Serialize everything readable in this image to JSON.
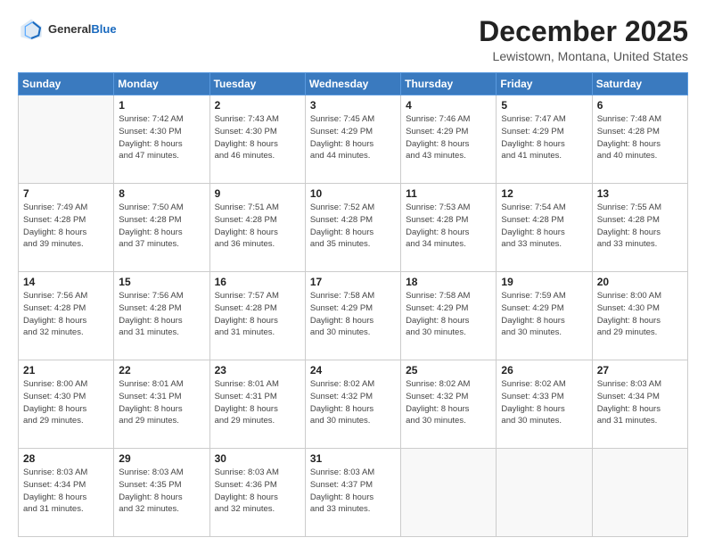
{
  "logo": {
    "general": "General",
    "blue": "Blue"
  },
  "header": {
    "month": "December 2025",
    "location": "Lewistown, Montana, United States"
  },
  "days_of_week": [
    "Sunday",
    "Monday",
    "Tuesday",
    "Wednesday",
    "Thursday",
    "Friday",
    "Saturday"
  ],
  "weeks": [
    [
      {
        "day": "",
        "info": ""
      },
      {
        "day": "1",
        "info": "Sunrise: 7:42 AM\nSunset: 4:30 PM\nDaylight: 8 hours\nand 47 minutes."
      },
      {
        "day": "2",
        "info": "Sunrise: 7:43 AM\nSunset: 4:30 PM\nDaylight: 8 hours\nand 46 minutes."
      },
      {
        "day": "3",
        "info": "Sunrise: 7:45 AM\nSunset: 4:29 PM\nDaylight: 8 hours\nand 44 minutes."
      },
      {
        "day": "4",
        "info": "Sunrise: 7:46 AM\nSunset: 4:29 PM\nDaylight: 8 hours\nand 43 minutes."
      },
      {
        "day": "5",
        "info": "Sunrise: 7:47 AM\nSunset: 4:29 PM\nDaylight: 8 hours\nand 41 minutes."
      },
      {
        "day": "6",
        "info": "Sunrise: 7:48 AM\nSunset: 4:28 PM\nDaylight: 8 hours\nand 40 minutes."
      }
    ],
    [
      {
        "day": "7",
        "info": "Sunrise: 7:49 AM\nSunset: 4:28 PM\nDaylight: 8 hours\nand 39 minutes."
      },
      {
        "day": "8",
        "info": "Sunrise: 7:50 AM\nSunset: 4:28 PM\nDaylight: 8 hours\nand 37 minutes."
      },
      {
        "day": "9",
        "info": "Sunrise: 7:51 AM\nSunset: 4:28 PM\nDaylight: 8 hours\nand 36 minutes."
      },
      {
        "day": "10",
        "info": "Sunrise: 7:52 AM\nSunset: 4:28 PM\nDaylight: 8 hours\nand 35 minutes."
      },
      {
        "day": "11",
        "info": "Sunrise: 7:53 AM\nSunset: 4:28 PM\nDaylight: 8 hours\nand 34 minutes."
      },
      {
        "day": "12",
        "info": "Sunrise: 7:54 AM\nSunset: 4:28 PM\nDaylight: 8 hours\nand 33 minutes."
      },
      {
        "day": "13",
        "info": "Sunrise: 7:55 AM\nSunset: 4:28 PM\nDaylight: 8 hours\nand 33 minutes."
      }
    ],
    [
      {
        "day": "14",
        "info": "Sunrise: 7:56 AM\nSunset: 4:28 PM\nDaylight: 8 hours\nand 32 minutes."
      },
      {
        "day": "15",
        "info": "Sunrise: 7:56 AM\nSunset: 4:28 PM\nDaylight: 8 hours\nand 31 minutes."
      },
      {
        "day": "16",
        "info": "Sunrise: 7:57 AM\nSunset: 4:28 PM\nDaylight: 8 hours\nand 31 minutes."
      },
      {
        "day": "17",
        "info": "Sunrise: 7:58 AM\nSunset: 4:29 PM\nDaylight: 8 hours\nand 30 minutes."
      },
      {
        "day": "18",
        "info": "Sunrise: 7:58 AM\nSunset: 4:29 PM\nDaylight: 8 hours\nand 30 minutes."
      },
      {
        "day": "19",
        "info": "Sunrise: 7:59 AM\nSunset: 4:29 PM\nDaylight: 8 hours\nand 30 minutes."
      },
      {
        "day": "20",
        "info": "Sunrise: 8:00 AM\nSunset: 4:30 PM\nDaylight: 8 hours\nand 29 minutes."
      }
    ],
    [
      {
        "day": "21",
        "info": "Sunrise: 8:00 AM\nSunset: 4:30 PM\nDaylight: 8 hours\nand 29 minutes."
      },
      {
        "day": "22",
        "info": "Sunrise: 8:01 AM\nSunset: 4:31 PM\nDaylight: 8 hours\nand 29 minutes."
      },
      {
        "day": "23",
        "info": "Sunrise: 8:01 AM\nSunset: 4:31 PM\nDaylight: 8 hours\nand 29 minutes."
      },
      {
        "day": "24",
        "info": "Sunrise: 8:02 AM\nSunset: 4:32 PM\nDaylight: 8 hours\nand 30 minutes."
      },
      {
        "day": "25",
        "info": "Sunrise: 8:02 AM\nSunset: 4:32 PM\nDaylight: 8 hours\nand 30 minutes."
      },
      {
        "day": "26",
        "info": "Sunrise: 8:02 AM\nSunset: 4:33 PM\nDaylight: 8 hours\nand 30 minutes."
      },
      {
        "day": "27",
        "info": "Sunrise: 8:03 AM\nSunset: 4:34 PM\nDaylight: 8 hours\nand 31 minutes."
      }
    ],
    [
      {
        "day": "28",
        "info": "Sunrise: 8:03 AM\nSunset: 4:34 PM\nDaylight: 8 hours\nand 31 minutes."
      },
      {
        "day": "29",
        "info": "Sunrise: 8:03 AM\nSunset: 4:35 PM\nDaylight: 8 hours\nand 32 minutes."
      },
      {
        "day": "30",
        "info": "Sunrise: 8:03 AM\nSunset: 4:36 PM\nDaylight: 8 hours\nand 32 minutes."
      },
      {
        "day": "31",
        "info": "Sunrise: 8:03 AM\nSunset: 4:37 PM\nDaylight: 8 hours\nand 33 minutes."
      },
      {
        "day": "",
        "info": ""
      },
      {
        "day": "",
        "info": ""
      },
      {
        "day": "",
        "info": ""
      }
    ]
  ]
}
